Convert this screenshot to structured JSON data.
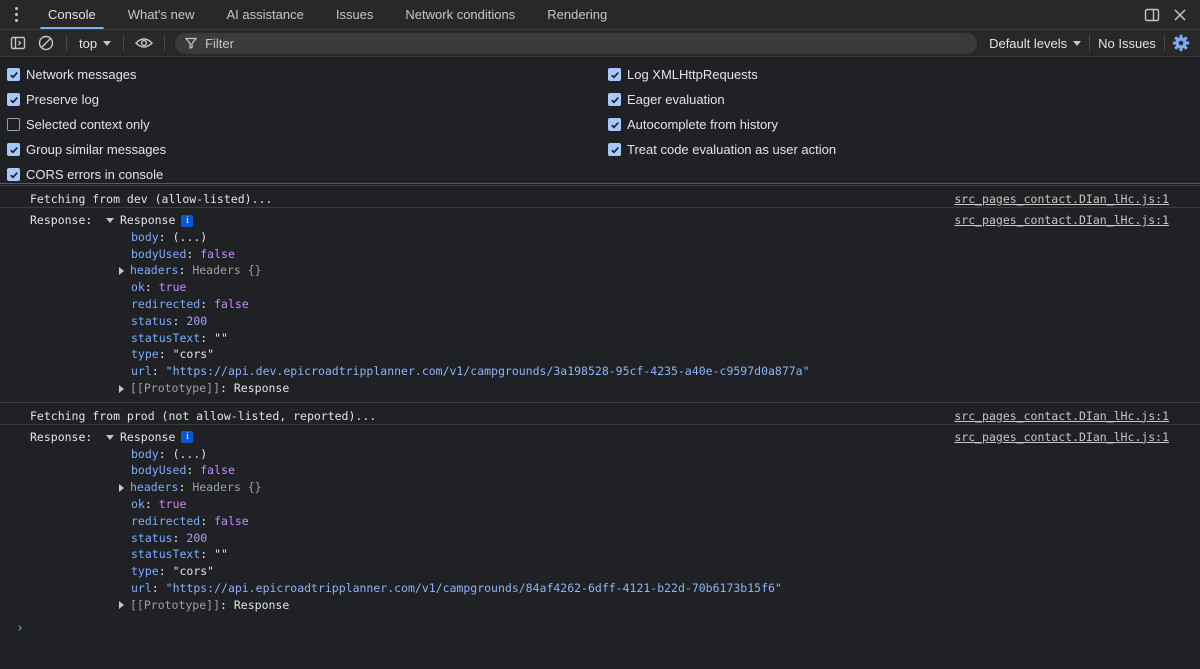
{
  "tabs": [
    {
      "label": "Console",
      "active": true
    },
    {
      "label": "What's new",
      "active": false
    },
    {
      "label": "AI assistance",
      "active": false
    },
    {
      "label": "Issues",
      "active": false
    },
    {
      "label": "Network conditions",
      "active": false
    },
    {
      "label": "Rendering",
      "active": false
    }
  ],
  "toolbar": {
    "context": "top",
    "filter_placeholder": "Filter",
    "levels": "Default levels",
    "issues": "No Issues"
  },
  "settings_left": [
    {
      "label": "Network messages",
      "checked": true
    },
    {
      "label": "Preserve log",
      "checked": true
    },
    {
      "label": "Selected context only",
      "checked": false
    },
    {
      "label": "Group similar messages",
      "checked": true
    },
    {
      "label": "CORS errors in console",
      "checked": true
    }
  ],
  "settings_right": [
    {
      "label": "Log XMLHttpRequests",
      "checked": true
    },
    {
      "label": "Eager evaluation",
      "checked": true
    },
    {
      "label": "Autocomplete from history",
      "checked": true
    },
    {
      "label": "Treat code evaluation as user action",
      "checked": true
    }
  ],
  "colors": {
    "accent": "#7cacf8",
    "checkbox": "#a8c7fa",
    "background": "#202124"
  },
  "messages": [
    {
      "log": "Fetching from dev (allow-listed)...",
      "log_source": "src_pages_contact.DIan_lHc.js:1",
      "response_label": "Response:",
      "response_source": "src_pages_contact.DIan_lHc.js:1",
      "object_name": "Response",
      "props": {
        "body": "(...)",
        "bodyUsed": "false",
        "headers": "Headers {}",
        "ok": "true",
        "redirected": "false",
        "status": "200",
        "statusText": "\"\"",
        "type": "\"cors\"",
        "url": "\"https://api.dev.epicroadtripplanner.com/v1/campgrounds/3a198528-95cf-4235-a40e-c9597d0a877a\"",
        "prototype_key": "[[Prototype]]",
        "prototype_value": "Response"
      }
    },
    {
      "log": "Fetching from prod (not allow-listed, reported)...",
      "log_source": "src_pages_contact.DIan_lHc.js:1",
      "response_label": "Response:",
      "response_source": "src_pages_contact.DIan_lHc.js:1",
      "object_name": "Response",
      "props": {
        "body": "(...)",
        "bodyUsed": "false",
        "headers": "Headers {}",
        "ok": "true",
        "redirected": "false",
        "status": "200",
        "statusText": "\"\"",
        "type": "\"cors\"",
        "url": "\"https://api.epicroadtripplanner.com/v1/campgrounds/84af4262-6dff-4121-b22d-70b6173b15f6\"",
        "prototype_key": "[[Prototype]]",
        "prototype_value": "Response"
      }
    }
  ],
  "prompt_symbol": "›"
}
